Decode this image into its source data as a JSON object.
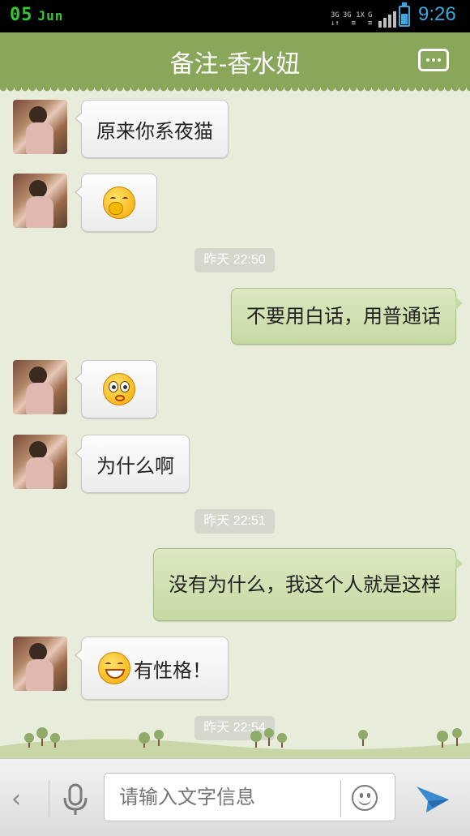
{
  "status_bar": {
    "date_day": "05",
    "date_month": "Jun",
    "network_labels": [
      "3G",
      "3G 1X",
      "G"
    ],
    "time": "9:26",
    "date_color": "#34c934",
    "accent_color": "#39a9e0"
  },
  "header": {
    "title": "备注-香水妞",
    "menu_icon": "chat-menu-icon",
    "background_color": "#8aa65a"
  },
  "messages": [
    {
      "side": "in",
      "type": "text",
      "text": "原来你系夜猫"
    },
    {
      "side": "in",
      "type": "emoji",
      "emoji": "shy-emoji"
    },
    {
      "type": "time",
      "text": "昨天 22:50"
    },
    {
      "side": "out",
      "type": "text",
      "text": "不要用白话，用普通话"
    },
    {
      "side": "in",
      "type": "emoji",
      "emoji": "dizzy-emoji"
    },
    {
      "side": "in",
      "type": "text",
      "text": "为什么啊"
    },
    {
      "type": "time",
      "text": "昨天 22:51"
    },
    {
      "side": "out",
      "type": "text",
      "text": "没有为什么，我这个人就是这样"
    },
    {
      "side": "in",
      "type": "emoji_text",
      "emoji": "grin-emoji",
      "text": "有性格！"
    },
    {
      "type": "time",
      "text": "昨天 22:54"
    }
  ],
  "input_bar": {
    "back_icon": "chevron-left-icon",
    "mic_icon": "microphone-icon",
    "placeholder": "请输入文字信息",
    "emoji_icon": "smiley-icon",
    "send_icon": "send-arrow-icon"
  }
}
